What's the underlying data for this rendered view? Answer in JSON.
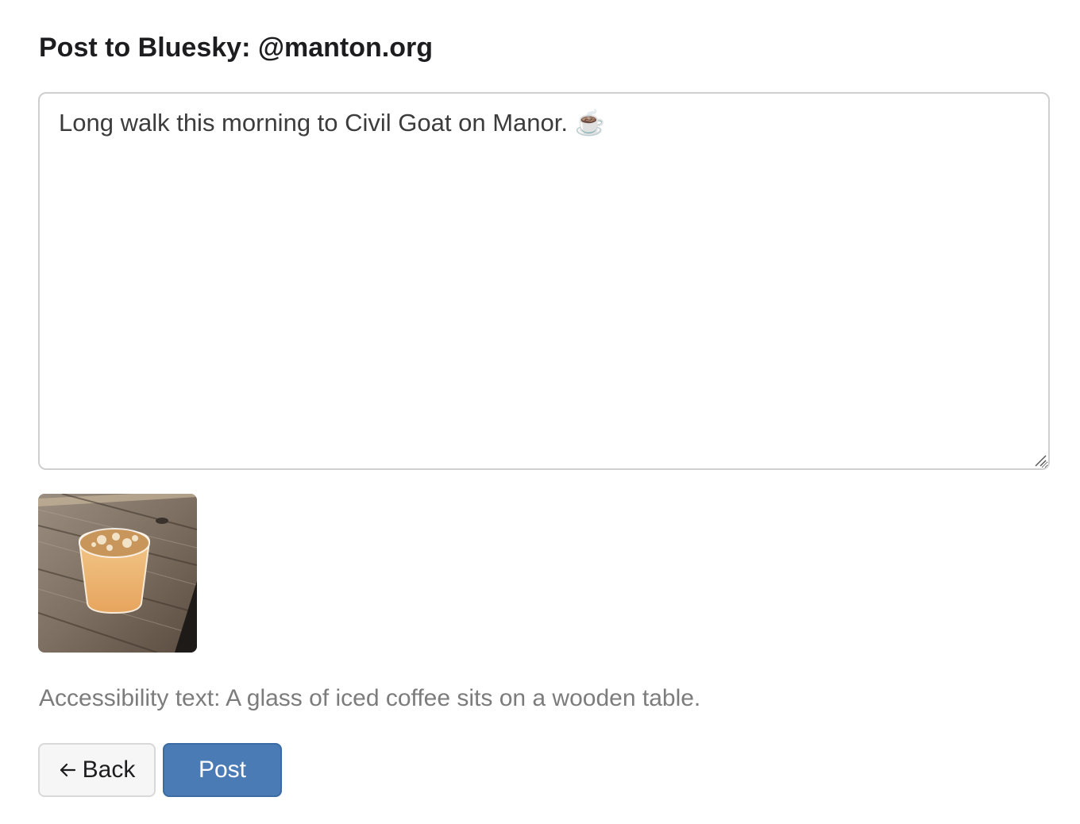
{
  "header": {
    "title": "Post to Bluesky: @manton.org"
  },
  "composer": {
    "text": "Long walk this morning to Civil Goat on Manor. ☕️"
  },
  "attachment": {
    "accessibility_text": "Accessibility text: A glass of iced coffee sits on a wooden table."
  },
  "actions": {
    "back_label": "Back",
    "post_label": "Post"
  },
  "colors": {
    "primary": "#4a7bb4",
    "secondary_bg": "#f6f6f6",
    "muted_text": "#7c7c7c"
  },
  "icons": {
    "back": "arrow-left-icon",
    "resize": "resize-grip-icon"
  }
}
